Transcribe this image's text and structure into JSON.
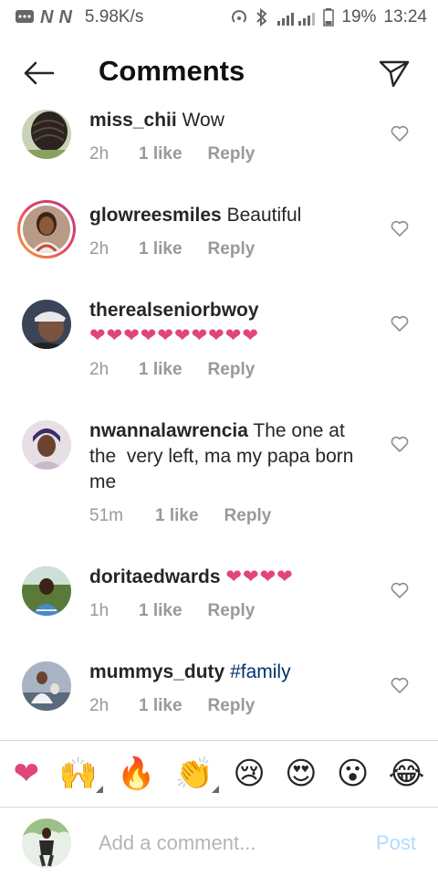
{
  "status": {
    "speed": "5.98K/s",
    "battery": "19%",
    "time": "13:24",
    "network_badges": [
      "N",
      "N"
    ]
  },
  "header": {
    "title": "Comments",
    "back_icon": "arrow-left-icon",
    "send_icon": "paper-plane-icon"
  },
  "comments": [
    {
      "username": "miss_chii",
      "text": "Wow",
      "time": "2h",
      "likes": "1 like",
      "reply": "Reply"
    },
    {
      "username": "glowreesmiles",
      "text": "Beautiful",
      "time": "2h",
      "likes": "1 like",
      "reply": "Reply",
      "has_story": true
    },
    {
      "username": "therealseniorbwoy",
      "text": "❤❤❤❤❤❤❤❤❤❤",
      "time": "2h",
      "likes": "1 like",
      "reply": "Reply"
    },
    {
      "username": "nwannalawrencia",
      "text": "The one at the  very left, ma my papa born me",
      "time": "51m",
      "likes": "1 like",
      "reply": "Reply"
    },
    {
      "username": "doritaedwards",
      "text": "❤❤❤❤",
      "time": "1h",
      "likes": "1 like",
      "reply": "Reply"
    },
    {
      "username": "mummys_duty",
      "text": "#family",
      "time": "2h",
      "likes": "1 like",
      "reply": "Reply"
    }
  ],
  "emoji_bar": [
    "❤",
    "🙌",
    "🔥",
    "👏",
    "😢",
    "😍",
    "😮",
    "😂"
  ],
  "composer": {
    "placeholder": "Add a comment...",
    "post_label": "Post"
  },
  "colors": {
    "heart_pink": "#e0457b",
    "hashtag": "#003569",
    "post_disabled": "#b3dbff"
  }
}
